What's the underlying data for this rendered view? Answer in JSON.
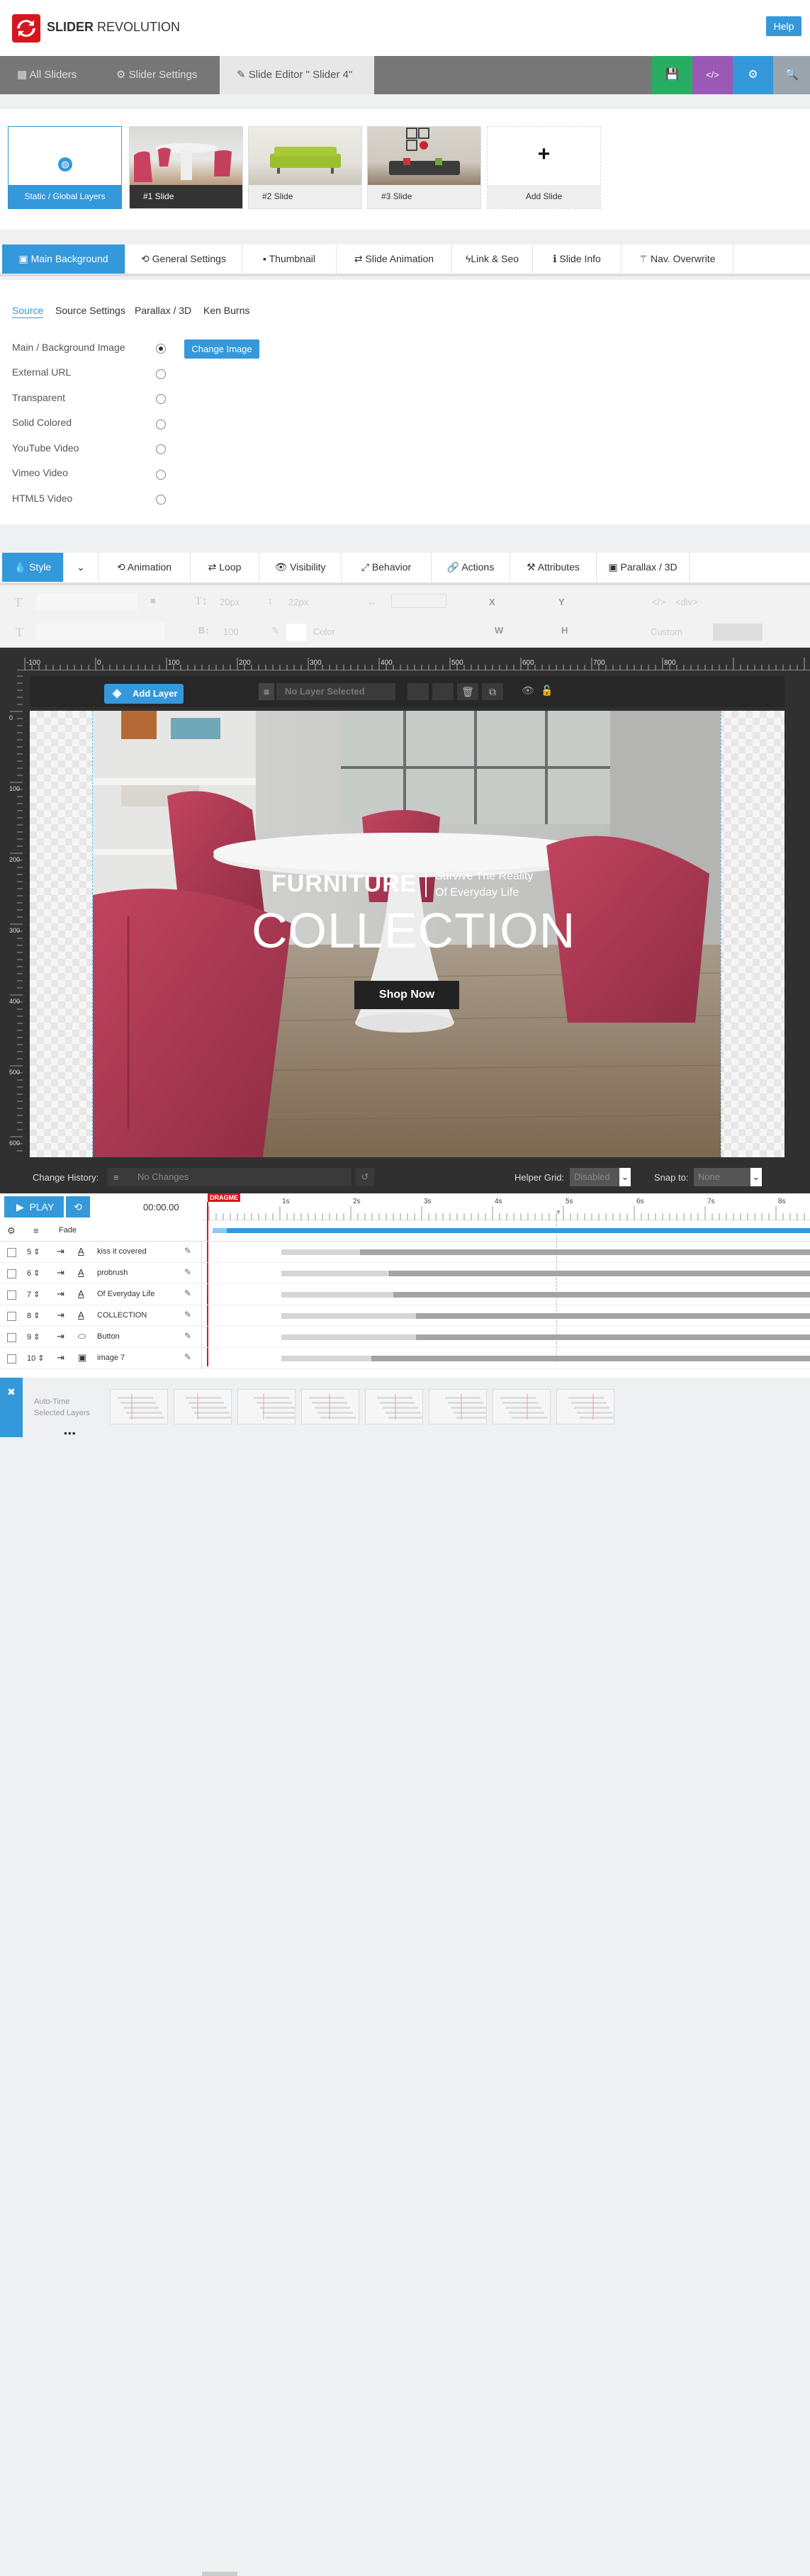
{
  "brand": {
    "name_bold": "SLIDER",
    "name_light": "REVOLUTION"
  },
  "header": {
    "help_label": "Help"
  },
  "nav": {
    "tabs": [
      {
        "label": "All Sliders"
      },
      {
        "label": "Slider Settings"
      },
      {
        "label": "Slide Editor \" Slider 4\""
      }
    ],
    "buttons": [
      "save-icon",
      "code-icon",
      "gear-icon",
      "search-icon"
    ]
  },
  "slides": [
    {
      "label": "Static / Global Layers"
    },
    {
      "label": "#1 Slide"
    },
    {
      "label": "#2 Slide"
    },
    {
      "label": "#3 Slide"
    },
    {
      "label": "Add Slide"
    }
  ],
  "settings_tabs": [
    "Main Background",
    "General Settings",
    "Thumbnail",
    "Slide Animation",
    "Link & Seo",
    "Slide Info",
    "Nav. Overwrite"
  ],
  "source_tabs": [
    "Source",
    "Source Settings",
    "Parallax / 3D",
    "Ken Burns"
  ],
  "source_options": [
    {
      "label": "Main / Background Image",
      "selected": true
    },
    {
      "label": "External URL",
      "selected": false
    },
    {
      "label": "Transparent",
      "selected": false
    },
    {
      "label": "Solid Colored",
      "selected": false
    },
    {
      "label": "YouTube Video",
      "selected": false
    },
    {
      "label": "Vimeo Video",
      "selected": false
    },
    {
      "label": "HTML5 Video",
      "selected": false
    }
  ],
  "change_image_label": "Change Image",
  "style_tabs": [
    "Style",
    "Animation",
    "Loop",
    "Visibility",
    "Behavior",
    "Actions",
    "Attributes",
    "Parallax / 3D"
  ],
  "toolbar": {
    "font_size": "20px",
    "line_height": "22px",
    "x_label": "X",
    "y_label": "Y",
    "tag": "<div>",
    "weight": "100",
    "color_label": "Color",
    "w_label": "W",
    "h_label": "H",
    "custom_label": "Custom"
  },
  "ruler": {
    "top": [
      "-100",
      "0",
      "100",
      "200",
      "300",
      "400",
      "500",
      "600",
      "700",
      "800"
    ],
    "left": [
      "0",
      "100",
      "200",
      "300",
      "400",
      "500",
      "600"
    ]
  },
  "layer_bar": {
    "add_layer": "Add Layer",
    "selected_layer": "No Layer Selected"
  },
  "slide_content": {
    "furniture": "FURNITURE",
    "tagline_1": "Survive The Reality",
    "tagline_2": "Of Everyday Life",
    "collection": "COLLECTION",
    "shop_now": "Shop Now"
  },
  "history": {
    "label": "Change History:",
    "value": "No Changes",
    "helper_grid_label": "Helper Grid:",
    "helper_grid_value": "Disabled",
    "snap_label": "Snap to:",
    "snap_value": "None"
  },
  "timeline": {
    "play": "PLAY",
    "time": "00:00.00",
    "dragme": "DRAGME",
    "seconds": [
      "1s",
      "2s",
      "3s",
      "4s",
      "5s",
      "6s",
      "7s",
      "8s"
    ],
    "header_effect": "Fade",
    "layers": [
      {
        "num": "5",
        "type": "text",
        "name": "kiss it covered",
        "in_start": 0.06,
        "in_end": 0.2
      },
      {
        "num": "6",
        "type": "text",
        "name": "probrush",
        "in_start": 0.06,
        "in_end": 0.25
      },
      {
        "num": "7",
        "type": "text",
        "name": "Of Everyday Life",
        "in_start": 0.06,
        "in_end": 0.26
      },
      {
        "num": "8",
        "type": "text",
        "name": "COLLECTION",
        "in_start": 0.06,
        "in_end": 0.3
      },
      {
        "num": "9",
        "type": "button",
        "name": "Button",
        "in_start": 0.06,
        "in_end": 0.3
      },
      {
        "num": "10",
        "type": "image",
        "name": "image 7",
        "in_start": 0.06,
        "in_end": 0.22
      }
    ]
  },
  "bottom": {
    "line1": "Auto-Time",
    "line2": "Selected Layers"
  },
  "colors": {
    "accent": "#3498db",
    "save": "#27ae60",
    "code": "#9b59b6",
    "brand": "#d6161f"
  }
}
